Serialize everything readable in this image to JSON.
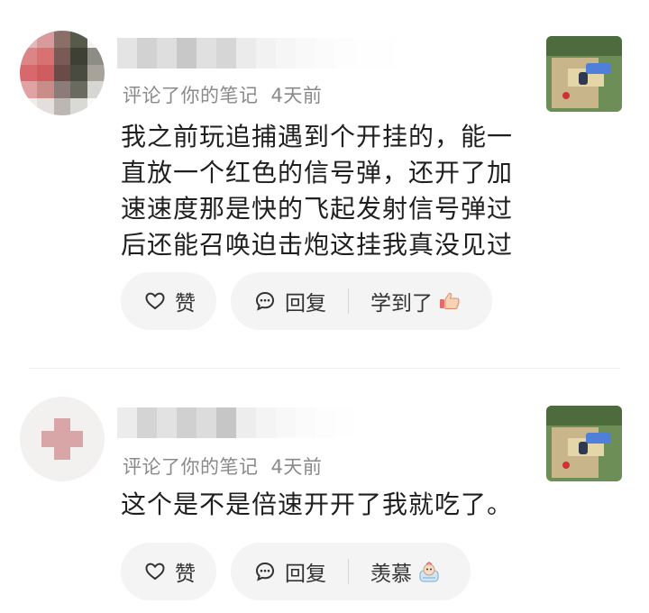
{
  "comments": [
    {
      "meta_action": "评论了你的笔记",
      "date": "4天前",
      "text_lines": [
        "我之前玩追捕遇到个开挂的，能一",
        "直放一个红色的信号弹，还开了加",
        "速速度那是快的飞起发射信号弹过",
        "后还能召唤迫击炮这挂我真没见过"
      ],
      "like_label": "赞",
      "reply_label": "回复",
      "reaction_label": "学到了",
      "reaction_emoji": "thumbs-up-hand-icon"
    },
    {
      "meta_action": "评论了你的笔记",
      "date": "4天前",
      "text_lines": [
        "这个是不是倍速开开了我就吃了。"
      ],
      "like_label": "赞",
      "reply_label": "回复",
      "reaction_label": "羡慕",
      "reaction_emoji": "envy-face-icon"
    }
  ],
  "colors": {
    "meta_gray": "#8a8a8a",
    "button_bg": "#f4f4f4",
    "divider": "#ececec"
  }
}
